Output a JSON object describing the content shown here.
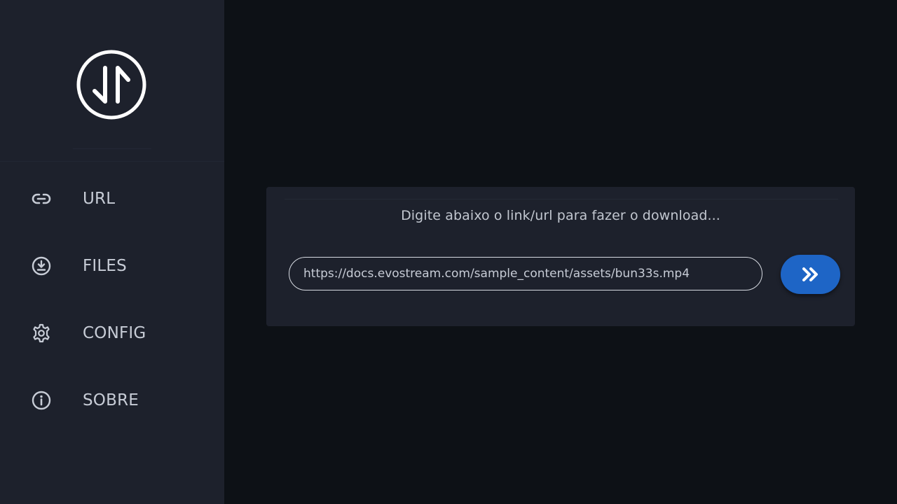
{
  "sidebar": {
    "logo": {
      "icon": "up-down-arrows-circle-logo"
    },
    "items": [
      {
        "label": "URL",
        "icon": "link-icon"
      },
      {
        "label": "FILES",
        "icon": "download-circle-icon"
      },
      {
        "label": "CONFIG",
        "icon": "gear-icon"
      },
      {
        "label": "SOBRE",
        "icon": "info-circle-icon"
      }
    ]
  },
  "main": {
    "prompt": "Digite abaixo o link/url para fazer o download...",
    "url_input": {
      "value": "https://docs.evostream.com/sample_content/assets/bun33s.mp4"
    },
    "go_button": {
      "icon": "double-chevron-right-icon"
    }
  },
  "colors": {
    "background": "#0d1116",
    "panel": "#1d212c",
    "accent": "#1e65c6",
    "text": "#c7ccd6"
  }
}
